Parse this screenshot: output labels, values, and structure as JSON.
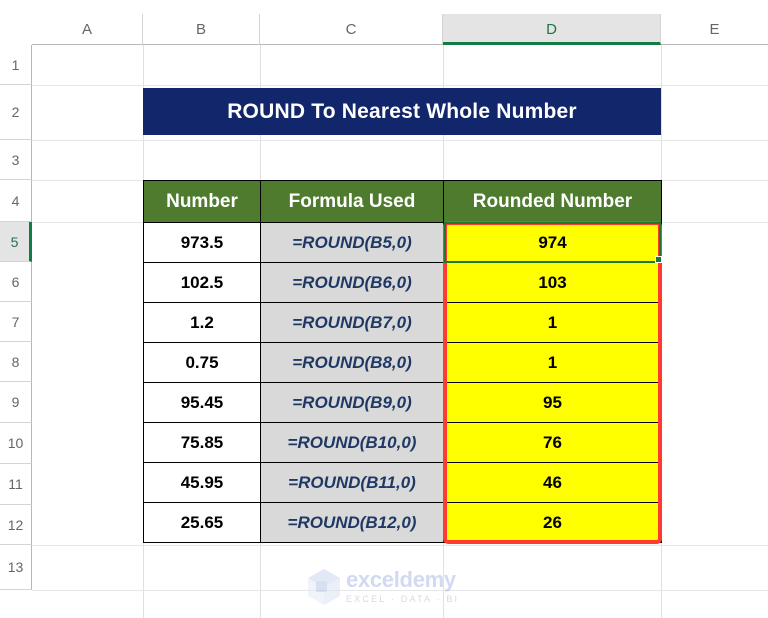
{
  "app": {
    "type": "spreadsheet",
    "selected_cell": "D5",
    "selected_column": "D",
    "selected_row": "5"
  },
  "grid": {
    "column_headers": [
      "A",
      "B",
      "C",
      "D",
      "E"
    ],
    "row_headers": [
      "1",
      "2",
      "3",
      "4",
      "5",
      "6",
      "7",
      "8",
      "9",
      "10",
      "11",
      "12",
      "13"
    ]
  },
  "title": {
    "text": "ROUND To Nearest Whole Number"
  },
  "table": {
    "headers": [
      "Number",
      "Formula Used",
      "Rounded Number"
    ],
    "rows": [
      {
        "number": "973.5",
        "formula": "=ROUND(B5,0)",
        "rounded": "974"
      },
      {
        "number": "102.5",
        "formula": "=ROUND(B6,0)",
        "rounded": "103"
      },
      {
        "number": "1.2",
        "formula": "=ROUND(B7,0)",
        "rounded": "1"
      },
      {
        "number": "0.75",
        "formula": "=ROUND(B8,0)",
        "rounded": "1"
      },
      {
        "number": "95.45",
        "formula": "=ROUND(B9,0)",
        "rounded": "95"
      },
      {
        "number": "75.85",
        "formula": "=ROUND(B10,0)",
        "rounded": "76"
      },
      {
        "number": "45.95",
        "formula": "=ROUND(B11,0)",
        "rounded": "46"
      },
      {
        "number": "25.65",
        "formula": "=ROUND(B12,0)",
        "rounded": "26"
      }
    ]
  },
  "watermark": {
    "name": "exceldemy",
    "tagline": "EXCEL · DATA · BI"
  },
  "colors": {
    "title_banner": "#12266b",
    "table_header": "#4f7b2e",
    "formula_cell": "#d9d9d9",
    "result_cell": "#ffff00",
    "highlight_border": "#ff3b30",
    "selection_border": "#1a7a2e",
    "formula_text": "#1f3864"
  }
}
